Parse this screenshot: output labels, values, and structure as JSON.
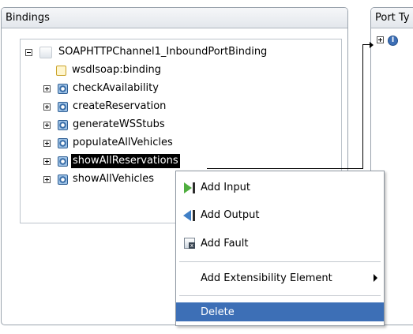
{
  "bindings_panel": {
    "title": "Bindings",
    "tree": {
      "root": {
        "label": "SOAPHTTPChannel1_InboundPortBinding",
        "icon": "binding-icon"
      },
      "binding_element": {
        "label": "wsdlsoap:binding",
        "icon": "soap-binding-icon"
      },
      "operations": [
        {
          "label": "checkAvailability",
          "icon": "operation-icon"
        },
        {
          "label": "createReservation",
          "icon": "operation-icon"
        },
        {
          "label": "generateWSStubs",
          "icon": "operation-icon"
        },
        {
          "label": "populateAllVehicles",
          "icon": "operation-icon"
        },
        {
          "label": "showAllReservations",
          "icon": "operation-icon",
          "selected": true
        },
        {
          "label": "showAllVehicles",
          "icon": "operation-icon"
        }
      ]
    }
  },
  "porttypes_panel": {
    "title": "Port Ty",
    "item_icon": "port-type-icon",
    "item_icon_glyph": "I"
  },
  "context_menu": {
    "items": [
      {
        "label": "Add Input",
        "icon": "add-input-icon"
      },
      {
        "label": "Add Output",
        "icon": "add-output-icon"
      },
      {
        "label": "Add Fault",
        "icon": "add-fault-icon",
        "icon_glyph": "x"
      },
      {
        "label": "Add Extensibility Element",
        "icon": "submenu-arrow-icon"
      },
      {
        "label": "Delete",
        "highlighted": true
      }
    ]
  },
  "colors": {
    "selection": "#000000",
    "menu_highlight": "#3d6fb6",
    "panel_border": "#9aa3ad",
    "header_gradient_top": "#f6f7f9",
    "header_gradient_bottom": "#e3e7ec"
  }
}
